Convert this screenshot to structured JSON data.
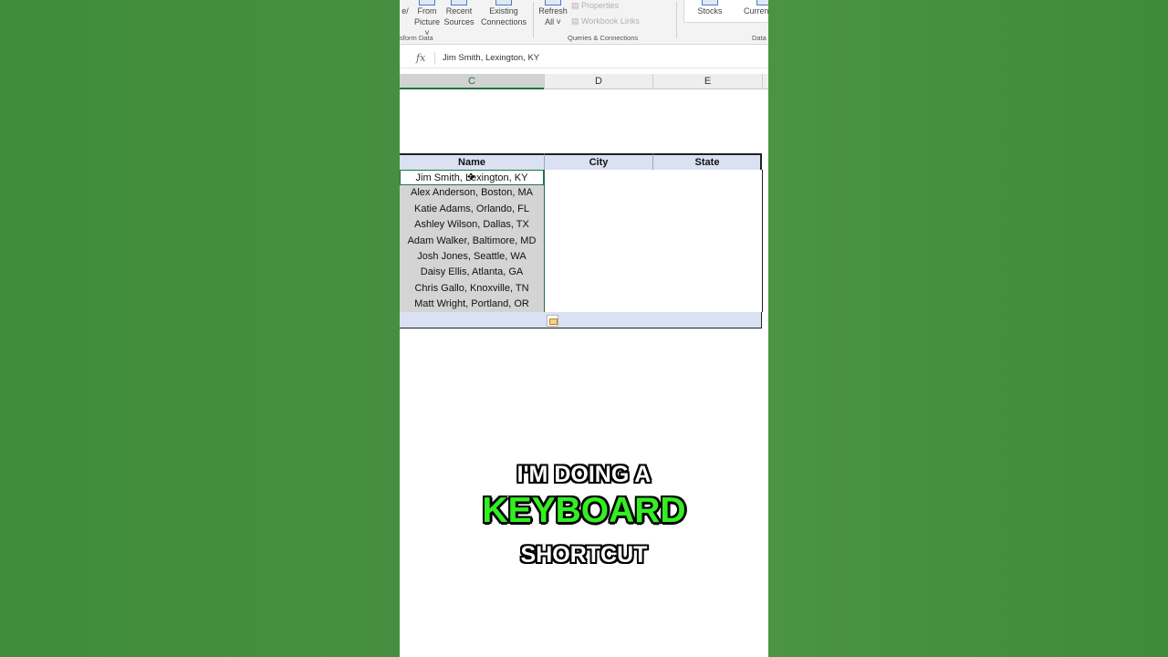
{
  "ribbon": {
    "get_data_partial": "e/",
    "from_picture": {
      "line1": "From",
      "line2": "Picture"
    },
    "recent_sources": {
      "line1": "Recent",
      "line2": "Sources"
    },
    "existing_connections": {
      "line1": "Existing",
      "line2": "Connections"
    },
    "refresh_all": {
      "line1": "Refresh",
      "line2": "All"
    },
    "properties": "Properties",
    "workbook_links": "Workbook Links",
    "stocks": "Stocks",
    "currencies_partial": "Curren",
    "group_transform": "sform Data",
    "group_queries": "Queries & Connections",
    "group_data_partial": "Data"
  },
  "formula_bar": {
    "fx": "fx",
    "value": "Jim Smith, Lexington, KY"
  },
  "columns": [
    "C",
    "D",
    "E"
  ],
  "table": {
    "headers": [
      "Name",
      "City",
      "State"
    ],
    "rows": [
      "Jim Smith, Lexington, KY",
      "Alex Anderson, Boston, MA",
      "Katie Adams, Orlando, FL",
      "Ashley Wilson, Dallas, TX",
      "Adam Walker, Baltimore, MD",
      "Josh Jones, Seattle, WA",
      "Daisy Ellis, Atlanta, GA",
      "Chris Gallo, Knoxville, TN",
      "Matt Wright, Portland, OR"
    ]
  },
  "captions": {
    "line1": "I'M DOING A",
    "line2": "KEYBOARD",
    "line3": "SHORTCUT"
  },
  "colors": {
    "background_green": "#3f8e3c",
    "table_header_blue": "#d9e1f2",
    "excel_green": "#217346",
    "caption_highlight": "#33ee22"
  }
}
